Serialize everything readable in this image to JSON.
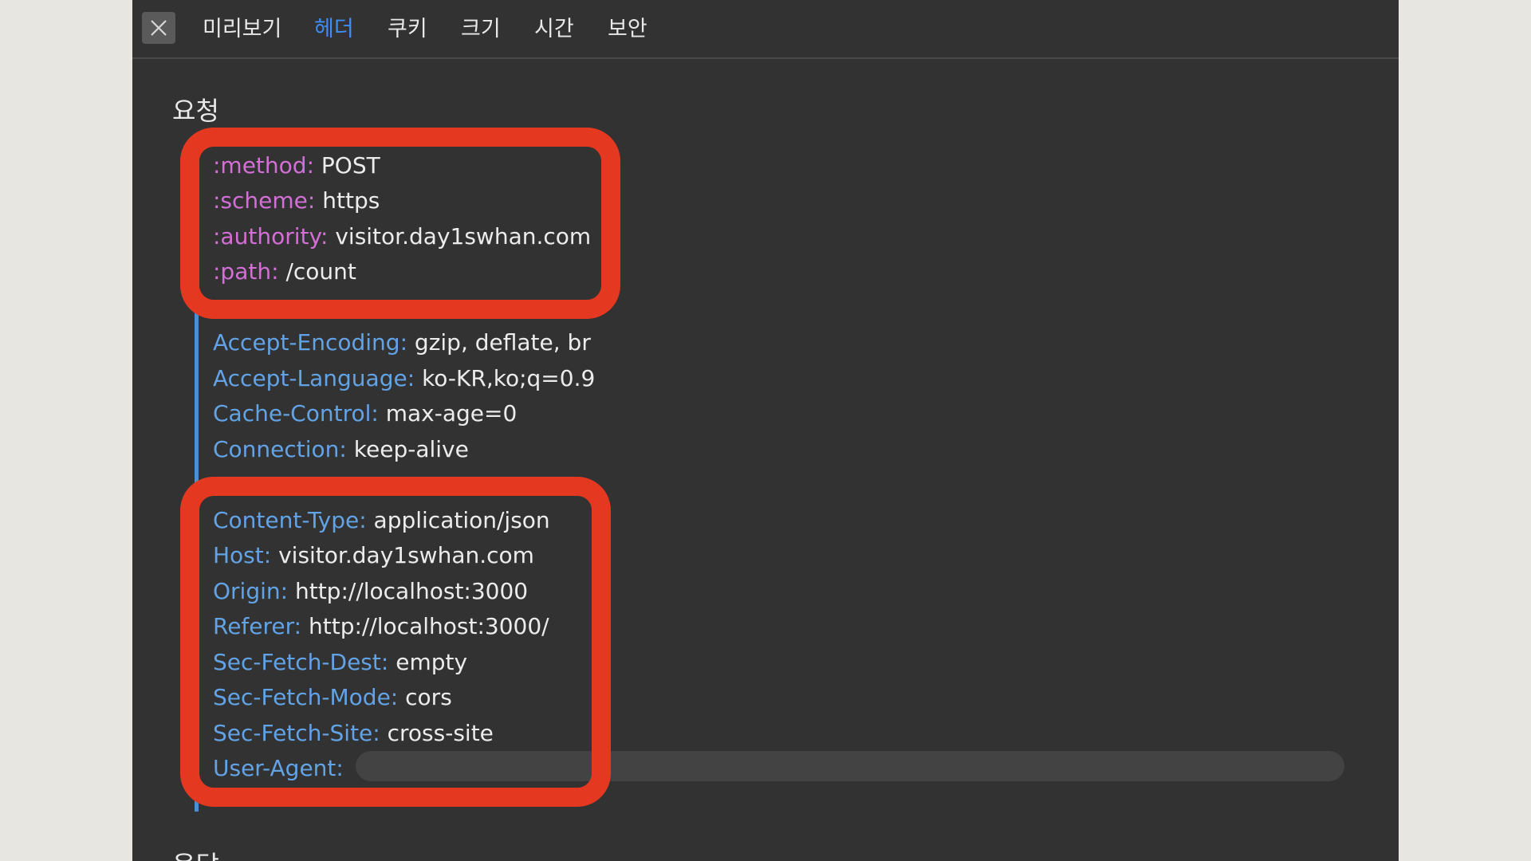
{
  "tabs": [
    {
      "label": "미리보기",
      "active": false
    },
    {
      "label": "헤더",
      "active": true
    },
    {
      "label": "쿠키",
      "active": false
    },
    {
      "label": "크기",
      "active": false
    },
    {
      "label": "시간",
      "active": false
    },
    {
      "label": "보안",
      "active": false
    }
  ],
  "section_request": "요청",
  "section_response": "응답",
  "icons": {
    "close": "close-icon"
  },
  "colors": {
    "panel_bg": "#323232",
    "pseudo_key": "#d36fd6",
    "header_key": "#62a3e6",
    "value": "#ececec",
    "highlight": "#e43920",
    "active_tab": "#3e8ef5"
  },
  "pseudo_headers": [
    {
      "key": ":method:",
      "value": "POST"
    },
    {
      "key": ":scheme:",
      "value": "https"
    },
    {
      "key": ":authority:",
      "value": "visitor.day1swhan.com"
    },
    {
      "key": ":path:",
      "value": "/count"
    }
  ],
  "headers_mid": [
    {
      "key": "Accept-Encoding:",
      "value": "gzip, deflate, br"
    },
    {
      "key": "Accept-Language:",
      "value": "ko-KR,ko;q=0.9"
    },
    {
      "key": "Cache-Control:",
      "value": "max-age=0"
    },
    {
      "key": "Connection:",
      "value": "keep-alive"
    }
  ],
  "headers_bottom": [
    {
      "key": "Content-Type:",
      "value": "application/json"
    },
    {
      "key": "Host:",
      "value": "visitor.day1swhan.com"
    },
    {
      "key": "Origin:",
      "value": "http://localhost:3000"
    },
    {
      "key": "Referer:",
      "value": "http://localhost:3000/"
    },
    {
      "key": "Sec-Fetch-Dest:",
      "value": "empty"
    },
    {
      "key": "Sec-Fetch-Mode:",
      "value": "cors"
    },
    {
      "key": "Sec-Fetch-Site:",
      "value": "cross-site"
    },
    {
      "key": "User-Agent:",
      "value": ""
    }
  ]
}
